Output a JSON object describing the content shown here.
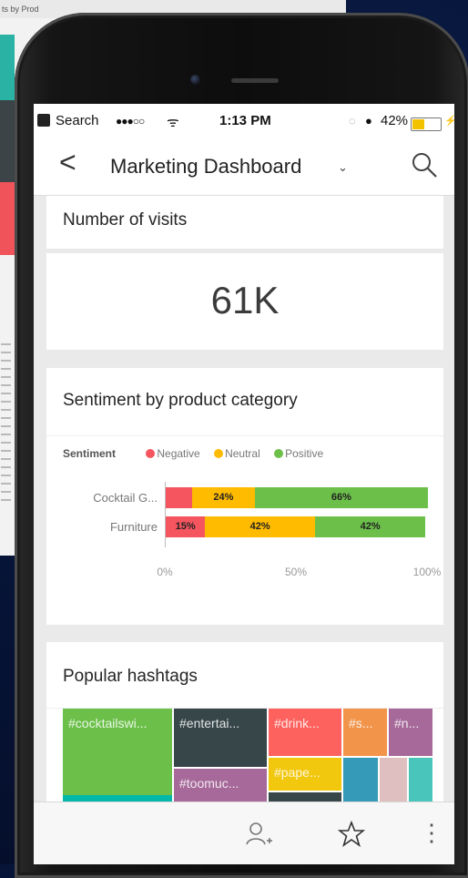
{
  "background": {
    "window_title": "ts by Prod"
  },
  "status_bar": {
    "carrier": "Search",
    "signal": "●●●○○",
    "wifi": "ᯤ",
    "time": "1:13 PM",
    "battery_pct": "42%",
    "battery_level": 0.42
  },
  "header": {
    "back": "<",
    "title": "Marketing Dashboard",
    "dropdown": "⌄"
  },
  "visits_card": {
    "title": "Number of visits",
    "value": "61K"
  },
  "sentiment_card": {
    "title": "Sentiment by product category",
    "legend_title": "Sentiment",
    "legend": [
      {
        "label": "Negative",
        "color": "#f4555f"
      },
      {
        "label": "Neutral",
        "color": "#ffbb00"
      },
      {
        "label": "Positive",
        "color": "#6cc04a"
      }
    ]
  },
  "chart_data": {
    "type": "bar",
    "orientation": "horizontal",
    "stacked": "100%",
    "title": "Sentiment by product category",
    "legend_title": "Sentiment",
    "categories": [
      "Cocktail G...",
      "Furniture"
    ],
    "series": [
      {
        "name": "Negative",
        "color": "#f4555f",
        "values": [
          10,
          15
        ],
        "labels": [
          "",
          "15%"
        ]
      },
      {
        "name": "Neutral",
        "color": "#ffbb00",
        "values": [
          24,
          42
        ],
        "labels": [
          "24%",
          "42%"
        ]
      },
      {
        "name": "Positive",
        "color": "#6cc04a",
        "values": [
          66,
          42
        ],
        "labels": [
          "66%",
          "42%"
        ]
      }
    ],
    "xticks": [
      "0%",
      "50%",
      "100%"
    ],
    "xlim": [
      0,
      100
    ],
    "grid": false,
    "legend_position": "top"
  },
  "hashtags_card": {
    "title": "Popular hashtags",
    "tiles": [
      {
        "label": "#cocktailswi...",
        "color": "#6cc04a"
      },
      {
        "label": "#entertai...",
        "color": "#374649"
      },
      {
        "label": "#drink...",
        "color": "#fd625e"
      },
      {
        "label": "#s...",
        "color": "#f2954b"
      },
      {
        "label": "#n...",
        "color": "#a66999"
      },
      {
        "label": "#toomuc...",
        "color": "#a66999"
      },
      {
        "label": "#pape...",
        "color": "#f2c80f"
      },
      {
        "label": "",
        "color": "#3599b8"
      },
      {
        "label": "",
        "color": "#dfbfbf"
      },
      {
        "label": "",
        "color": "#4ac5bb"
      },
      {
        "label": "",
        "color": "#01b8aa"
      }
    ]
  },
  "bottom_bar": {
    "icons": [
      "person-add-icon",
      "star-icon",
      "more-icon"
    ],
    "more": "⋮"
  }
}
